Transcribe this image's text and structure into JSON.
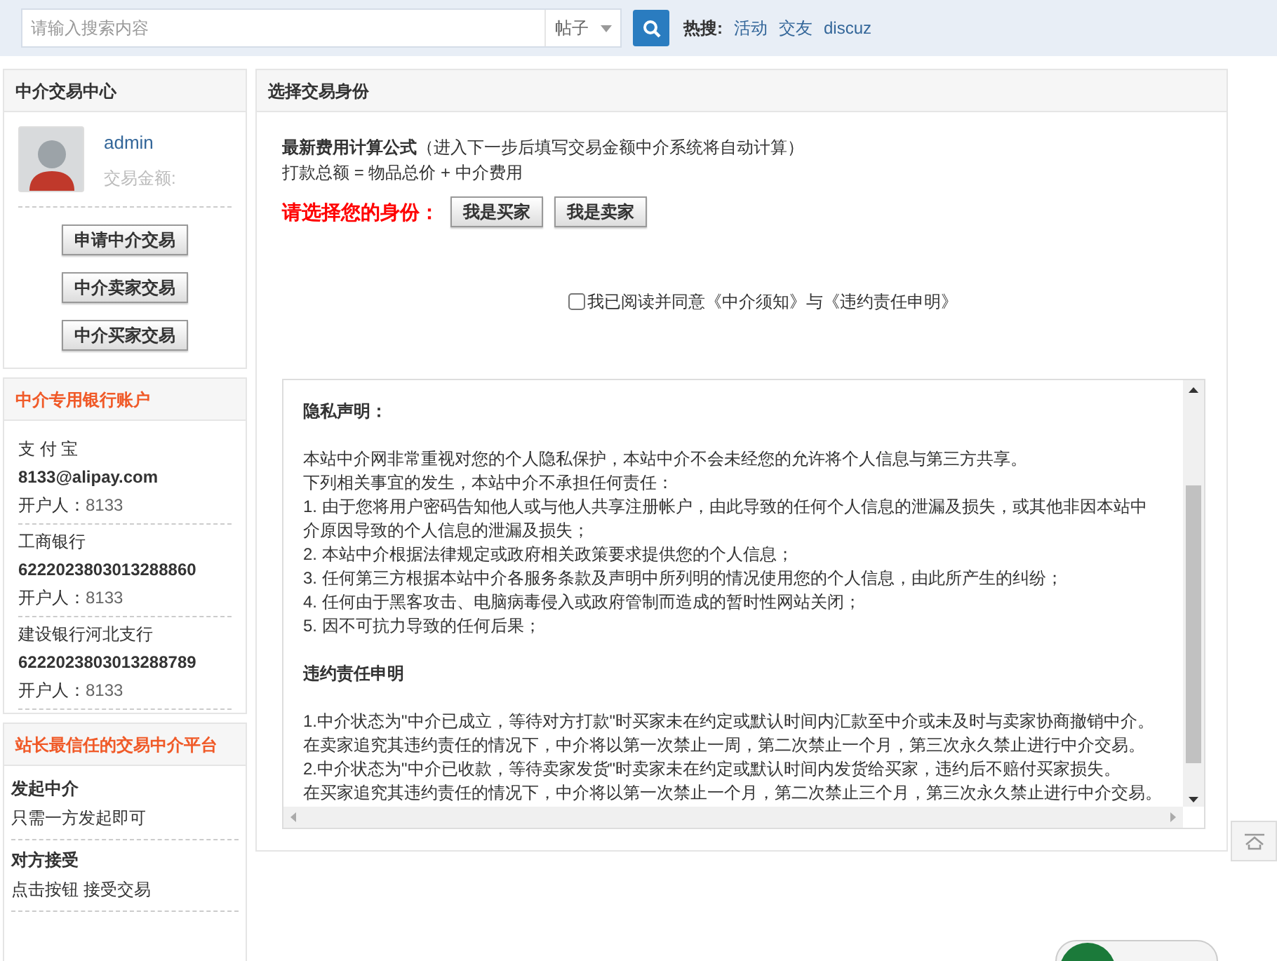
{
  "search": {
    "placeholder": "请输入搜索内容",
    "category": "帖子",
    "hot_label": "热搜:",
    "hot_links": [
      "活动",
      "交友",
      "discuz"
    ]
  },
  "sidebar": {
    "center": {
      "title": "中介交易中心",
      "username": "admin",
      "amount_label": "交易金额:",
      "buttons": [
        "申请中介交易",
        "中介卖家交易",
        "中介买家交易"
      ]
    },
    "bank": {
      "title": "中介专用银行账户",
      "accounts": [
        {
          "name": "支 付 宝",
          "number": "8133@alipay.com",
          "holder_label": "开户人：",
          "holder": "8133"
        },
        {
          "name": "工商银行",
          "number": "6222023803013288860",
          "holder_label": "开户人：",
          "holder": "8133"
        },
        {
          "name": "建设银行河北支行",
          "number": "6222023803013288789",
          "holder_label": "开户人：",
          "holder": "8133"
        }
      ]
    },
    "platform": {
      "title": "站长最信任的交易中介平台",
      "steps": [
        {
          "title": "发起中介",
          "text": "只需一方发起即可"
        },
        {
          "title": "对方接受",
          "text": "点击按钮 接受交易"
        }
      ]
    }
  },
  "main": {
    "title": "选择交易身份",
    "formula_title": "最新费用计算公式",
    "formula_note": "（进入下一步后填写交易金额中介系统将自动计算）",
    "formula": "打款总额 = 物品总价 + 中介费用",
    "identity_label": "请选择您的身份：",
    "identity_buttons": [
      "我是买家",
      "我是卖家"
    ],
    "agree": {
      "checked": false,
      "label": "我已阅读并同意《中介须知》与《违约责任申明》"
    },
    "terms": [
      {
        "kind": "heading",
        "text": "隐私声明："
      },
      {
        "kind": "gap"
      },
      {
        "kind": "line",
        "text": "本站中介网非常重视对您的个人隐私保护，本站中介不会未经您的允许将个人信息与第三方共享。"
      },
      {
        "kind": "line",
        "text": "下列相关事宜的发生，本站中介不承担任何责任："
      },
      {
        "kind": "line",
        "text": "1. 由于您将用户密码告知他人或与他人共享注册帐户，由此导致的任何个人信息的泄漏及损失，或其他非因本站中介原因导致的个人信息的泄漏及损失；"
      },
      {
        "kind": "line",
        "text": "2. 本站中介根据法律规定或政府相关政策要求提供您的个人信息；"
      },
      {
        "kind": "line",
        "text": "3. 任何第三方根据本站中介各服务条款及声明中所列明的情况使用您的个人信息，由此所产生的纠纷；"
      },
      {
        "kind": "line",
        "text": "4. 任何由于黑客攻击、电脑病毒侵入或政府管制而造成的暂时性网站关闭；"
      },
      {
        "kind": "line",
        "text": "5. 因不可抗力导致的任何后果；"
      },
      {
        "kind": "gap"
      },
      {
        "kind": "heading",
        "text": "违约责任申明"
      },
      {
        "kind": "gap"
      },
      {
        "kind": "line",
        "text": "1.中介状态为\"中介已成立，等待对方打款\"时买家未在约定或默认时间内汇款至中介或未及时与卖家协商撤销中介。"
      },
      {
        "kind": "line",
        "text": "在卖家追究其违约责任的情况下，中介将以第一次禁止一周，第二次禁止一个月，第三次永久禁止进行中介交易。"
      },
      {
        "kind": "line",
        "text": "2.中介状态为\"中介已收款，等待卖家发货\"时卖家未在约定或默认时间内发货给买家，违约后不赔付买家损失。"
      },
      {
        "kind": "line",
        "text": "在买家追究其违约责任的情况下，中介将以第一次禁止一个月，第二次禁止三个月，第三次永久禁止进行中介交易。"
      }
    ]
  }
}
